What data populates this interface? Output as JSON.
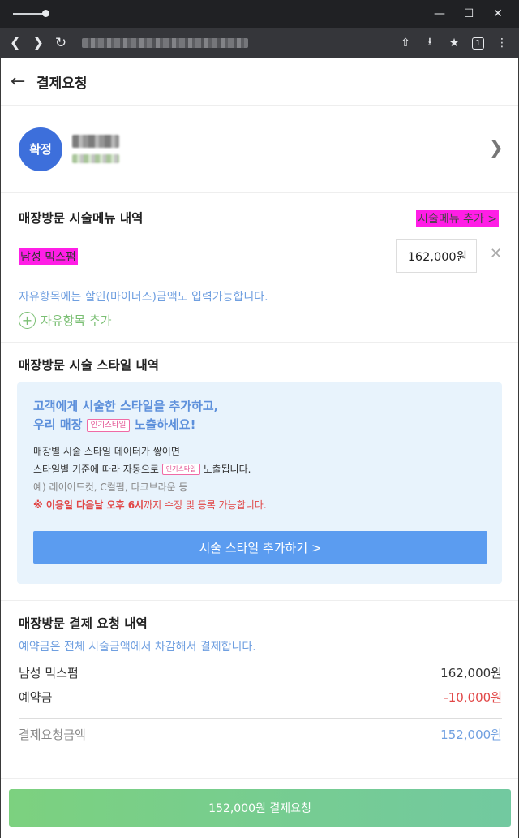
{
  "browser": {
    "window_controls": {
      "minimize": "—",
      "maximize": "☐",
      "close": "✕"
    },
    "tab_count": "1"
  },
  "header": {
    "title": "결제요청"
  },
  "customer": {
    "status_badge": "확정"
  },
  "menu_section": {
    "title": "매장방문 시술메뉴 내역",
    "add_menu_link": "시술메뉴 추가 >",
    "item_name": "남성 믹스펌",
    "item_price": "162,000원",
    "hint": "자유항목에는 할인(마이너스)금액도 입력가능합니다.",
    "free_item_add": "자유항목 추가"
  },
  "style_section": {
    "title": "매장방문 시술 스타일 내역",
    "promo_line1": "고객에게 시술한 스타일을 추가하고,",
    "promo_line2_prefix": "우리 매장",
    "promo_pill": "인기스타일",
    "promo_line2_suffix": "노출하세요!",
    "body_line1": "매장별 시술 스타일 데이터가 쌓이면",
    "body_line2_prefix": "스타일별 기준에 따라 자동으로",
    "body_line2_suffix": "노출됩니다.",
    "body_example": "예) 레이어드컷, C컬펌, 다크브라운 등",
    "warn_bold": "※ 이용일 다음날 오후 6시",
    "warn_rest": "까지 수정 및 등록 가능합니다.",
    "add_style_button": "시술 스타일 추가하기 >"
  },
  "payment_section": {
    "title": "매장방문 결제 요청 내역",
    "note": "예약금은 전체 시술금액에서 차감해서 결제합니다.",
    "rows": [
      {
        "label": "남성 믹스펌",
        "amount": "162,000원"
      },
      {
        "label": "예약금",
        "amount": "-10,000원"
      }
    ],
    "total_label": "결제요청금액",
    "total_amount": "152,000원"
  },
  "footer": {
    "pay_button": "152,000원 결제요청"
  },
  "colors": {
    "accent_blue": "#3d6fdb",
    "link_blue": "#6f9fe0",
    "green": "#7bbf74",
    "warning_red": "#e14646",
    "highlight_magenta": "#ff1ee6"
  }
}
